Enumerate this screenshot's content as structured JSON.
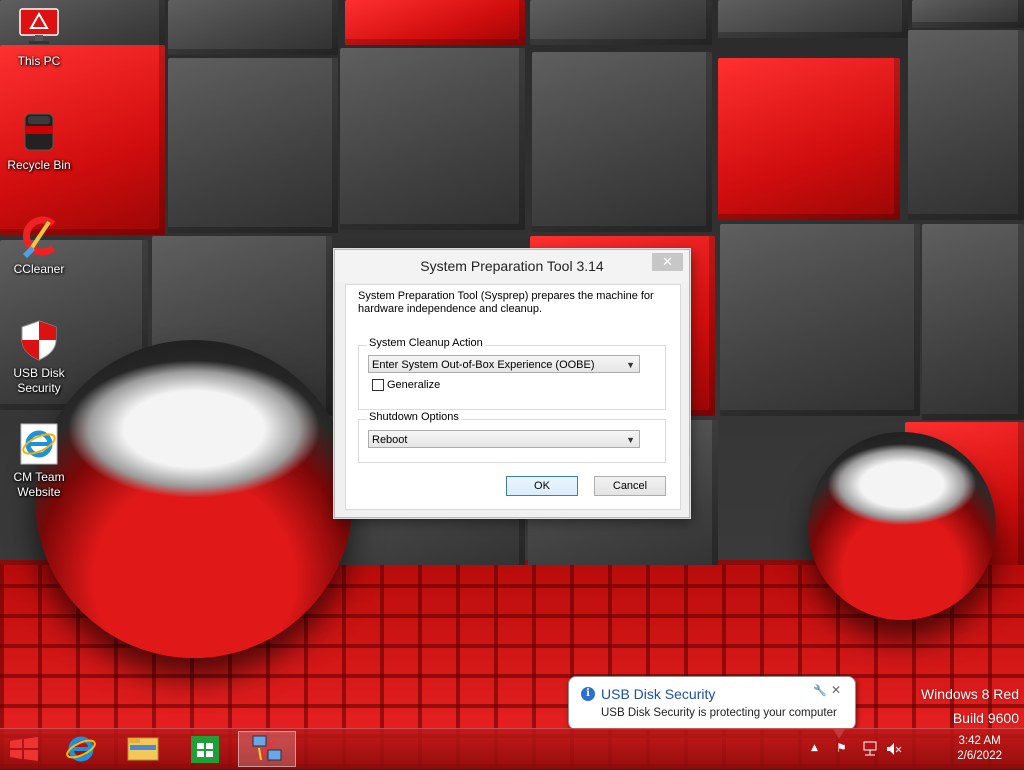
{
  "desktop": {
    "icons": [
      {
        "label": "This PC",
        "icon": "this-pc-icon"
      },
      {
        "label": "Recycle Bin",
        "icon": "recycle-bin-icon"
      },
      {
        "label": "CCleaner",
        "icon": "ccleaner-icon"
      },
      {
        "label": "USB Disk\nSecurity",
        "icon": "shield-icon"
      },
      {
        "label": "CM Team\nWebsite",
        "icon": "internet-explorer-icon"
      }
    ]
  },
  "dialog": {
    "title": "System Preparation Tool 3.14",
    "close_glyph": "✕",
    "description": "System Preparation Tool (Sysprep) prepares the machine for hardware independence and cleanup.",
    "cleanup_group_label": "System Cleanup Action",
    "cleanup_selected": "Enter System Out-of-Box Experience (OOBE)",
    "generalize_label": "Generalize",
    "generalize_checked": false,
    "shutdown_group_label": "Shutdown Options",
    "shutdown_selected": "Reboot",
    "ok_label": "OK",
    "cancel_label": "Cancel"
  },
  "notification": {
    "title": "USB Disk Security",
    "body": "USB Disk Security is protecting your computer",
    "close_glyph": "✕"
  },
  "watermark": {
    "edition": "Windows 8 Red",
    "build": "Build 9600"
  },
  "taskbar": {
    "items": [
      "start-button",
      "internet-explorer",
      "file-explorer",
      "windows-store",
      "network-tool"
    ],
    "clock_time": "3:42 AM",
    "clock_date": "2/6/2022"
  },
  "colors": {
    "accent_red": "#d01515",
    "notification_title": "#1c4fa6",
    "default_button_border": "#3c7fb1"
  }
}
